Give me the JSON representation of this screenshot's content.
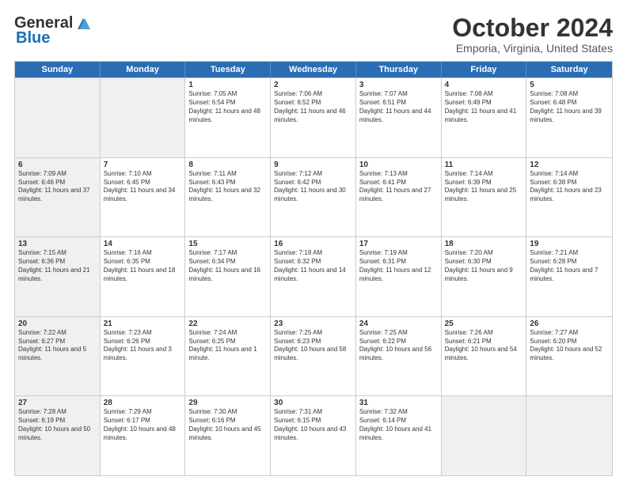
{
  "header": {
    "logo_general": "General",
    "logo_blue": "Blue",
    "month_title": "October 2024",
    "location": "Emporia, Virginia, United States"
  },
  "days_of_week": [
    "Sunday",
    "Monday",
    "Tuesday",
    "Wednesday",
    "Thursday",
    "Friday",
    "Saturday"
  ],
  "rows": [
    [
      {
        "day": "",
        "info": "",
        "shaded": true
      },
      {
        "day": "",
        "info": "",
        "shaded": true
      },
      {
        "day": "1",
        "info": "Sunrise: 7:05 AM\nSunset: 6:54 PM\nDaylight: 11 hours and 48 minutes.",
        "shaded": false
      },
      {
        "day": "2",
        "info": "Sunrise: 7:06 AM\nSunset: 6:52 PM\nDaylight: 11 hours and 46 minutes.",
        "shaded": false
      },
      {
        "day": "3",
        "info": "Sunrise: 7:07 AM\nSunset: 6:51 PM\nDaylight: 11 hours and 44 minutes.",
        "shaded": false
      },
      {
        "day": "4",
        "info": "Sunrise: 7:08 AM\nSunset: 6:49 PM\nDaylight: 11 hours and 41 minutes.",
        "shaded": false
      },
      {
        "day": "5",
        "info": "Sunrise: 7:08 AM\nSunset: 6:48 PM\nDaylight: 11 hours and 39 minutes.",
        "shaded": false
      }
    ],
    [
      {
        "day": "6",
        "info": "Sunrise: 7:09 AM\nSunset: 6:46 PM\nDaylight: 11 hours and 37 minutes.",
        "shaded": true
      },
      {
        "day": "7",
        "info": "Sunrise: 7:10 AM\nSunset: 6:45 PM\nDaylight: 11 hours and 34 minutes.",
        "shaded": false
      },
      {
        "day": "8",
        "info": "Sunrise: 7:11 AM\nSunset: 6:43 PM\nDaylight: 11 hours and 32 minutes.",
        "shaded": false
      },
      {
        "day": "9",
        "info": "Sunrise: 7:12 AM\nSunset: 6:42 PM\nDaylight: 11 hours and 30 minutes.",
        "shaded": false
      },
      {
        "day": "10",
        "info": "Sunrise: 7:13 AM\nSunset: 6:41 PM\nDaylight: 11 hours and 27 minutes.",
        "shaded": false
      },
      {
        "day": "11",
        "info": "Sunrise: 7:14 AM\nSunset: 6:39 PM\nDaylight: 11 hours and 25 minutes.",
        "shaded": false
      },
      {
        "day": "12",
        "info": "Sunrise: 7:14 AM\nSunset: 6:38 PM\nDaylight: 11 hours and 23 minutes.",
        "shaded": false
      }
    ],
    [
      {
        "day": "13",
        "info": "Sunrise: 7:15 AM\nSunset: 6:36 PM\nDaylight: 11 hours and 21 minutes.",
        "shaded": true
      },
      {
        "day": "14",
        "info": "Sunrise: 7:16 AM\nSunset: 6:35 PM\nDaylight: 11 hours and 18 minutes.",
        "shaded": false
      },
      {
        "day": "15",
        "info": "Sunrise: 7:17 AM\nSunset: 6:34 PM\nDaylight: 11 hours and 16 minutes.",
        "shaded": false
      },
      {
        "day": "16",
        "info": "Sunrise: 7:18 AM\nSunset: 6:32 PM\nDaylight: 11 hours and 14 minutes.",
        "shaded": false
      },
      {
        "day": "17",
        "info": "Sunrise: 7:19 AM\nSunset: 6:31 PM\nDaylight: 11 hours and 12 minutes.",
        "shaded": false
      },
      {
        "day": "18",
        "info": "Sunrise: 7:20 AM\nSunset: 6:30 PM\nDaylight: 11 hours and 9 minutes.",
        "shaded": false
      },
      {
        "day": "19",
        "info": "Sunrise: 7:21 AM\nSunset: 6:28 PM\nDaylight: 11 hours and 7 minutes.",
        "shaded": false
      }
    ],
    [
      {
        "day": "20",
        "info": "Sunrise: 7:22 AM\nSunset: 6:27 PM\nDaylight: 11 hours and 5 minutes.",
        "shaded": true
      },
      {
        "day": "21",
        "info": "Sunrise: 7:23 AM\nSunset: 6:26 PM\nDaylight: 11 hours and 3 minutes.",
        "shaded": false
      },
      {
        "day": "22",
        "info": "Sunrise: 7:24 AM\nSunset: 6:25 PM\nDaylight: 11 hours and 1 minute.",
        "shaded": false
      },
      {
        "day": "23",
        "info": "Sunrise: 7:25 AM\nSunset: 6:23 PM\nDaylight: 10 hours and 58 minutes.",
        "shaded": false
      },
      {
        "day": "24",
        "info": "Sunrise: 7:25 AM\nSunset: 6:22 PM\nDaylight: 10 hours and 56 minutes.",
        "shaded": false
      },
      {
        "day": "25",
        "info": "Sunrise: 7:26 AM\nSunset: 6:21 PM\nDaylight: 10 hours and 54 minutes.",
        "shaded": false
      },
      {
        "day": "26",
        "info": "Sunrise: 7:27 AM\nSunset: 6:20 PM\nDaylight: 10 hours and 52 minutes.",
        "shaded": false
      }
    ],
    [
      {
        "day": "27",
        "info": "Sunrise: 7:28 AM\nSunset: 6:19 PM\nDaylight: 10 hours and 50 minutes.",
        "shaded": true
      },
      {
        "day": "28",
        "info": "Sunrise: 7:29 AM\nSunset: 6:17 PM\nDaylight: 10 hours and 48 minutes.",
        "shaded": false
      },
      {
        "day": "29",
        "info": "Sunrise: 7:30 AM\nSunset: 6:16 PM\nDaylight: 10 hours and 45 minutes.",
        "shaded": false
      },
      {
        "day": "30",
        "info": "Sunrise: 7:31 AM\nSunset: 6:15 PM\nDaylight: 10 hours and 43 minutes.",
        "shaded": false
      },
      {
        "day": "31",
        "info": "Sunrise: 7:32 AM\nSunset: 6:14 PM\nDaylight: 10 hours and 41 minutes.",
        "shaded": false
      },
      {
        "day": "",
        "info": "",
        "shaded": true
      },
      {
        "day": "",
        "info": "",
        "shaded": true
      }
    ]
  ]
}
